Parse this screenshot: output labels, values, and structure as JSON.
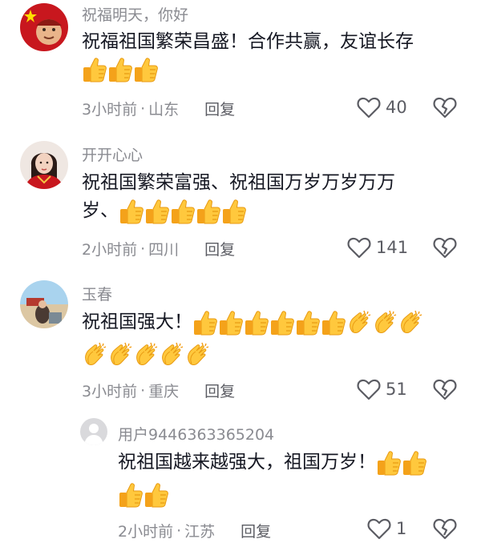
{
  "comments": [
    {
      "username": "祝福明天，你好",
      "text": "祝福祖国繁荣昌盛！合作共赢，友谊长存",
      "emojis": [
        "thumbs-up-icon",
        "thumbs-up-icon",
        "thumbs-up-icon"
      ],
      "time": "3小时前",
      "location": "山东",
      "reply_label": "回复",
      "likes": "40",
      "avatar": "flag-avatar"
    },
    {
      "username": "开开心心",
      "text_line1": "祝祖国繁荣富强、祝祖国万岁万岁万万",
      "text_line2": "岁、",
      "emojis": [
        "thumbs-up-icon",
        "thumbs-up-icon",
        "thumbs-up-icon",
        "thumbs-up-icon",
        "thumbs-up-icon"
      ],
      "time": "2小时前",
      "location": "四川",
      "reply_label": "回复",
      "likes": "141",
      "avatar": "woman-avatar"
    },
    {
      "username": "玉春",
      "text": "祝祖国强大！",
      "emojis_row1": [
        "thumbs-up-icon",
        "thumbs-up-icon",
        "thumbs-up-icon",
        "thumbs-up-icon",
        "thumbs-up-icon",
        "thumbs-up-icon",
        "clapping-hands-icon",
        "clapping-hands-icon",
        "clapping-hands-icon"
      ],
      "emojis_row2": [
        "clapping-hands-icon",
        "clapping-hands-icon",
        "clapping-hands-icon",
        "clapping-hands-icon",
        "clapping-hands-icon"
      ],
      "time": "3小时前",
      "location": "重庆",
      "reply_label": "回复",
      "likes": "51",
      "avatar": "beach-avatar"
    },
    {
      "username": "用户9446363365204",
      "text": "祝祖国越来越强大，祖国万岁！",
      "emojis_inline": [
        "thumbs-up-icon",
        "thumbs-up-icon"
      ],
      "emojis_row2": [
        "thumbs-up-icon",
        "thumbs-up-icon"
      ],
      "time": "2小时前",
      "location": "江苏",
      "reply_label": "回复",
      "likes": "1",
      "avatar": "default-user-avatar"
    }
  ],
  "meta_separator": "·",
  "colors": {
    "text_primary": "#161823",
    "text_secondary": "#8a8b91",
    "emoji_yellow": "#ffc83d",
    "emoji_shade": "#f4a21a"
  }
}
